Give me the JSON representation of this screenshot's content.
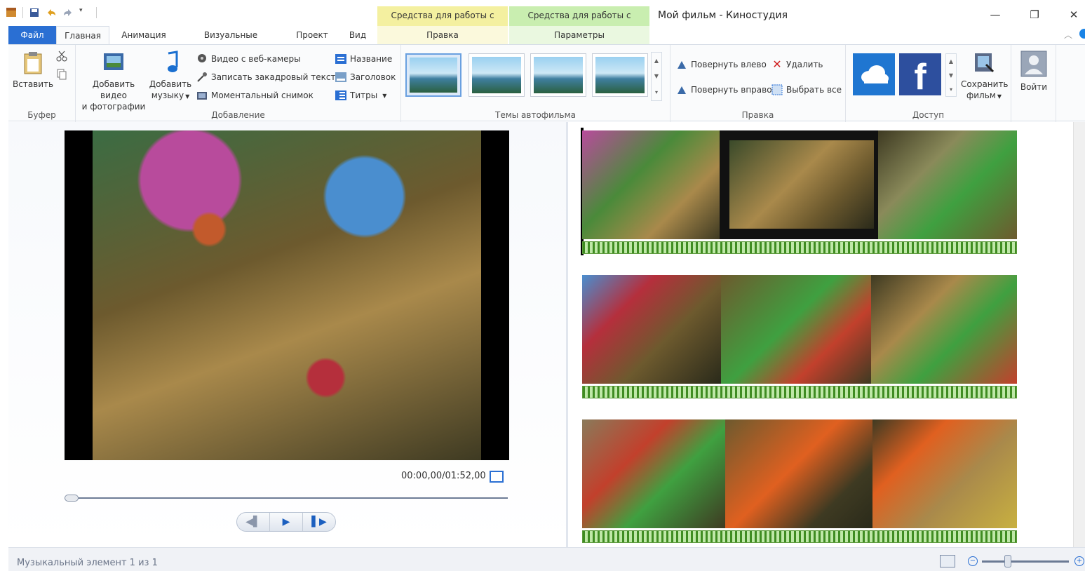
{
  "titlebar": {
    "window_title": "Мой фильм - Киностудия",
    "context_video": "Средства для работы с видео",
    "context_music": "Средства для работы с музыкой",
    "minimize": "—",
    "restore": "❐",
    "close": "✕"
  },
  "tabs": {
    "file": "Файл",
    "home": "Главная",
    "animation": "Анимация",
    "visual_effects": "Визуальные эффекты",
    "project": "Проект",
    "view": "Вид",
    "edit": "Правка",
    "options": "Параметры"
  },
  "ribbon": {
    "clipboard": {
      "paste": "Вставить",
      "label": "Буфер"
    },
    "add": {
      "add_video_line1": "Добавить видео",
      "add_video_line2": "и фотографии",
      "add_music_line1": "Добавить",
      "add_music_line2": "музыку",
      "webcam": "Видео с веб-камеры",
      "narration": "Записать закадровый текст",
      "snapshot": "Моментальный снимок",
      "title": "Название",
      "caption": "Заголовок",
      "credits": "Титры",
      "label": "Добавление"
    },
    "themes": {
      "label": "Темы автофильма"
    },
    "editing": {
      "rotate_left": "Повернуть влево",
      "rotate_right": "Повернуть вправо",
      "delete": "Удалить",
      "select_all": "Выбрать все",
      "label": "Правка"
    },
    "share": {
      "label": "Доступ",
      "facebook_letter": "f",
      "save_movie_line1": "Сохранить",
      "save_movie_line2": "фильм"
    },
    "signin": {
      "label": "Войти"
    }
  },
  "preview": {
    "timecode": "00:00,00/01:52,00"
  },
  "status": {
    "text": "Музыкальный элемент 1 из 1",
    "zoom_minus": "−",
    "zoom_plus": "+"
  },
  "colors": {
    "accent": "#2a6fd3",
    "context_video": "#f4f0a0",
    "context_music": "#c9eeb0",
    "music_track": "#3f8c22"
  },
  "icons": {
    "app": "movie-maker-icon",
    "save": "save-icon",
    "undo": "undo-icon",
    "redo": "redo-icon",
    "paste": "clipboard-icon",
    "cut": "scissors-icon",
    "copy": "copy-icon",
    "webcam": "webcam-icon",
    "microphone": "microphone-icon",
    "snapshot": "camera-icon",
    "onedrive": "cloud-icon",
    "facebook": "facebook-icon",
    "save_movie": "film-save-icon",
    "signin": "user-icon"
  }
}
